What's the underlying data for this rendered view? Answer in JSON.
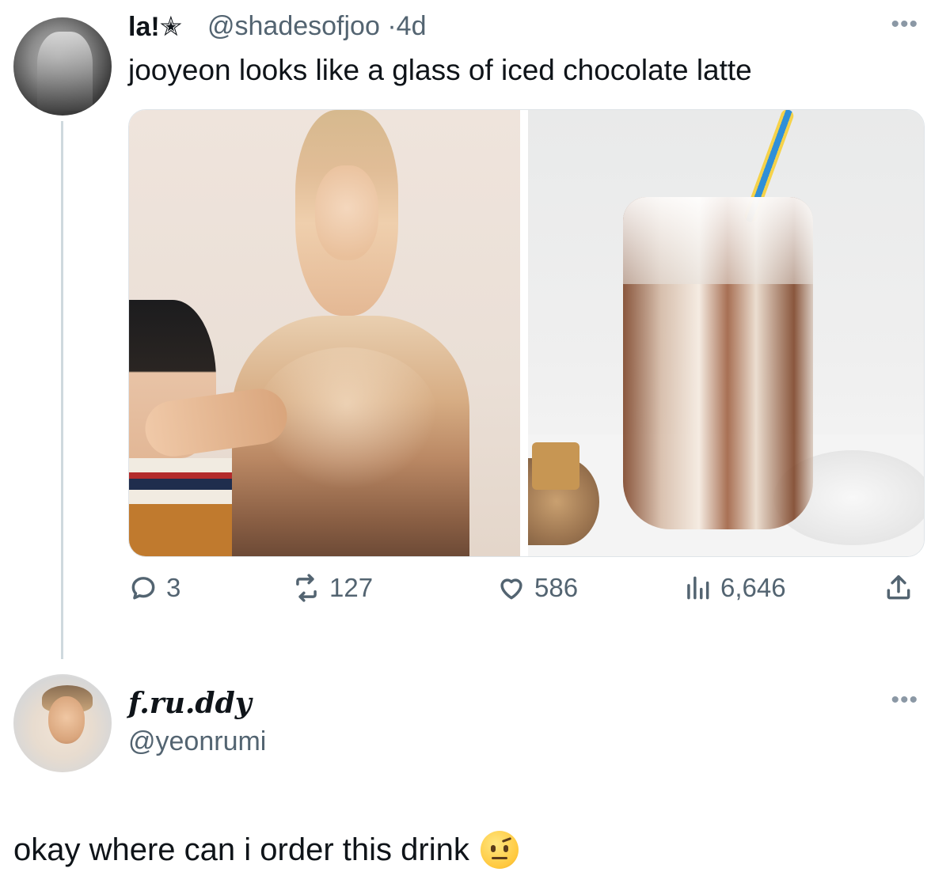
{
  "original_tweet": {
    "display_name": "la!✭",
    "handle": "@shadesofjoo",
    "separator": "·",
    "age": "4d",
    "text": "jooyeon looks like a glass of iced chocolate latte",
    "more_label": "•••",
    "media": [
      {
        "subject": "photo-person-sweater"
      },
      {
        "subject": "photo-iced-chocolate-latte"
      }
    ],
    "actions": {
      "replies": "3",
      "retweets": "127",
      "likes": "586",
      "views": "6,646"
    },
    "icons": [
      "reply-icon",
      "retweet-icon",
      "like-icon",
      "views-icon",
      "share-icon"
    ]
  },
  "reply_tweet": {
    "display_name": "f.ru.ddy",
    "handle": "@yeonrumi",
    "more_label": "•••",
    "text": "okay where can i order this drink",
    "emoji": "raised-eyebrow-emoji"
  },
  "colors": {
    "text": "#0f1419",
    "secondary_text": "#536471",
    "thread_line": "#cfd9de"
  }
}
